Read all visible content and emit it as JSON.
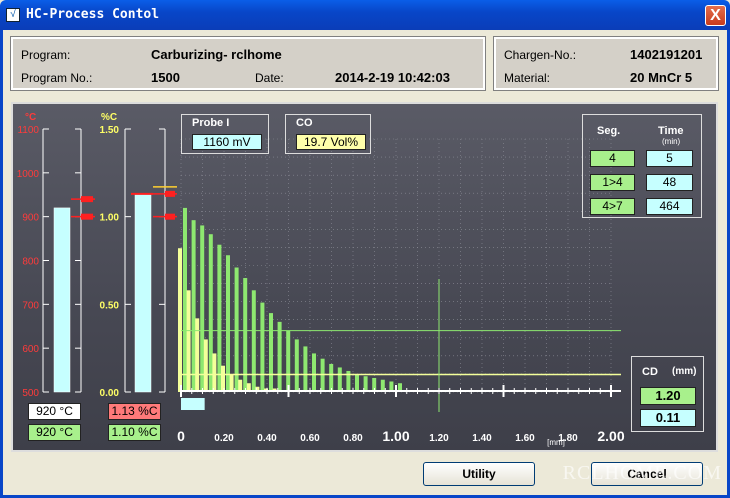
{
  "window": {
    "title": "HC-Process Contol",
    "close_label": "X"
  },
  "info_left": {
    "program_label": "Program:",
    "program_value": "Carburizing- rclhome",
    "program_no_label": "Program No.:",
    "program_no_value": "1500",
    "date_label": "Date:",
    "date_value": "2014-2-19 10:42:03"
  },
  "info_right": {
    "chargen_label": "Chargen-No.:",
    "chargen_value": "1402191201",
    "material_label": "Material:",
    "material_value": "20 MnCr 5"
  },
  "temp_gauge": {
    "unit": "°C",
    "ticks": [
      "1100",
      "1000",
      "900",
      "800",
      "700",
      "600",
      "500"
    ],
    "min": 500,
    "max": 1100,
    "bar_value": 920,
    "set_value": 920,
    "marker_high": 940,
    "marker_low": 900,
    "readout_actual": "920 °C",
    "readout_set": "920 °C"
  },
  "carbon_gauge": {
    "unit": "%C",
    "ticks": [
      "1.50",
      "1.00",
      "0.50",
      "0.00"
    ],
    "min": 0,
    "max": 1.5,
    "bar_value": 1.13,
    "marker_high": 1.13,
    "marker_low": 1.0,
    "marker_yellow": 1.17,
    "readout_actual": "1.13 %C",
    "readout_set": "1.10 %C"
  },
  "probe": {
    "label": "Probe I",
    "value": "1160 mV"
  },
  "co": {
    "label": "CO",
    "value": "19.7 Vol%"
  },
  "segments": {
    "seg_header": "Seg.",
    "time_header": "Time",
    "time_unit": "(min)",
    "rows": [
      {
        "seg": "4",
        "time": "5"
      },
      {
        "seg": "1>4",
        "time": "48"
      },
      {
        "seg": "4>7",
        "time": "464"
      }
    ]
  },
  "cd": {
    "label": "CD",
    "unit": "(mm)",
    "value1": "1.20",
    "value2": "0.11"
  },
  "chart_data": {
    "type": "bar",
    "x_ticks": [
      "0",
      "0.20",
      "0.40",
      "0.60",
      "0.80",
      "1.00",
      "1.20",
      "1.40",
      "1.60",
      "1.80",
      "2.00"
    ],
    "x_unit": "[mm]",
    "xlim": [
      0,
      2.0
    ],
    "ylim": [
      0,
      1.5
    ],
    "series": [
      {
        "x": [
          0.0,
          0.04,
          0.08,
          0.12,
          0.16,
          0.2,
          0.24,
          0.28,
          0.32,
          0.36,
          0.4,
          0.44,
          0.48,
          0.52,
          0.56,
          0.6,
          0.64,
          0.68,
          0.72,
          0.76,
          0.8,
          0.84,
          0.88,
          0.92,
          0.96,
          1.0
        ],
        "values": [
          1.05,
          0.98,
          0.95,
          0.9,
          0.84,
          0.78,
          0.71,
          0.65,
          0.58,
          0.51,
          0.45,
          0.4,
          0.35,
          0.3,
          0.26,
          0.22,
          0.19,
          0.16,
          0.14,
          0.12,
          0.1,
          0.09,
          0.08,
          0.07,
          0.06,
          0.05
        ]
      },
      {
        "x": [
          0.0,
          0.04,
          0.08,
          0.12,
          0.16,
          0.2,
          0.24,
          0.28,
          0.32,
          0.36,
          0.4,
          0.44,
          0.48,
          0.52,
          0.56,
          0.6,
          0.64
        ],
        "values": [
          0.82,
          0.58,
          0.42,
          0.3,
          0.22,
          0.15,
          0.1,
          0.07,
          0.05,
          0.03,
          0.02,
          0.02,
          0.01,
          0.01,
          0.01,
          0.01,
          0.01
        ]
      }
    ],
    "baseline_carbon": 0.1,
    "reference_carbon": 0.35,
    "cd_line_x": 1.2,
    "progress_fraction": 0.055
  },
  "buttons": {
    "utility": "Utility",
    "cancel": "Cancel"
  },
  "watermark": "RCLHOME.COM"
}
